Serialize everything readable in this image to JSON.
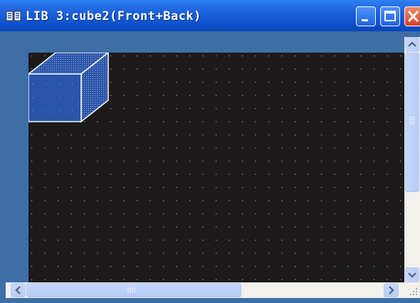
{
  "window": {
    "title": "LIB 3:cube2(Front+Back)",
    "controls": [
      "minimize",
      "maximize",
      "close"
    ]
  },
  "canvas": {
    "background": "#1c1a1a",
    "grid_dots": true,
    "shape": "cube",
    "shape_fill": "#2a55a8",
    "shape_outline": "#ffffff"
  },
  "icons": {
    "app": "book-icon",
    "scroll_up": "arrow-up-icon",
    "scroll_down": "arrow-down-icon",
    "scroll_left": "arrow-left-icon",
    "scroll_right": "arrow-right-icon"
  },
  "colors": {
    "title_bar": "#1e63df",
    "frame": "#3d6ea5",
    "close_button": "#d8412c"
  }
}
